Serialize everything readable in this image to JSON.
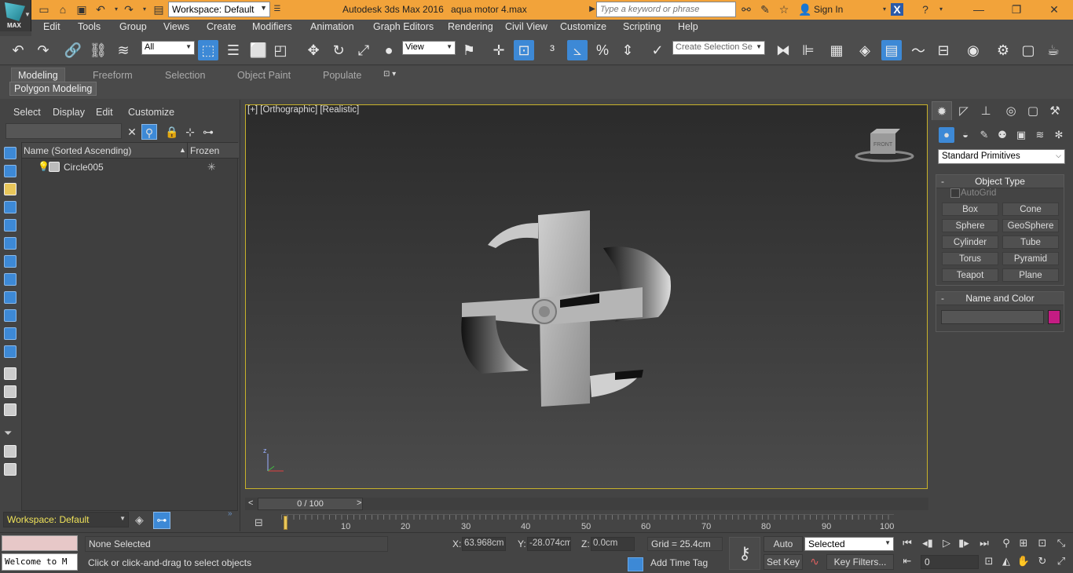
{
  "title_bar": {
    "workspace": "Workspace: Default",
    "app_name": "Autodesk 3ds Max 2016",
    "file_name": "aqua motor 4.max",
    "search_placeholder": "Type a keyword or phrase",
    "sign_in": "Sign In",
    "logo_text": "MAX"
  },
  "menu": [
    "Edit",
    "Tools",
    "Group",
    "Views",
    "Create",
    "Modifiers",
    "Animation",
    "Graph Editors",
    "Rendering",
    "Civil View",
    "Customize",
    "Scripting",
    "Help"
  ],
  "toolbar": {
    "filter_select": "All",
    "ref_coord_select": "View",
    "selection_set": "Create Selection Se"
  },
  "ribbon": {
    "tabs": [
      "Modeling",
      "Freeform",
      "Selection",
      "Object Paint",
      "Populate"
    ],
    "active_tab": "Modeling",
    "panel_label": "Polygon Modeling"
  },
  "scene_explorer": {
    "menu": [
      "Select",
      "Display",
      "Edit",
      "Customize"
    ],
    "columns": [
      "Name (Sorted Ascending)",
      "Frozen"
    ],
    "rows": [
      {
        "name": "Circle005"
      }
    ],
    "workspace": "Workspace: Default"
  },
  "viewport": {
    "label": "[+] [Orthographic] [Realistic]",
    "viewcube_face": "FRONT",
    "axis_z": "z"
  },
  "command_panel": {
    "category": "Standard Primitives",
    "object_type_title": "Object Type",
    "autogrid": "AutoGrid",
    "primitives": [
      "Box",
      "Cone",
      "Sphere",
      "GeoSphere",
      "Cylinder",
      "Tube",
      "Torus",
      "Pyramid",
      "Teapot",
      "Plane"
    ],
    "name_color_title": "Name and Color",
    "object_color": "#c41c83"
  },
  "timeline": {
    "frame_display": "0 / 100",
    "ticks": [
      "0",
      "10",
      "20",
      "30",
      "40",
      "50",
      "60",
      "70",
      "80",
      "90",
      "100"
    ]
  },
  "status": {
    "maxscript": "Welcome to M",
    "selection": "None Selected",
    "prompt": "Click or click-and-drag to select objects",
    "x_label": "X:",
    "x_value": "63.968cm",
    "y_label": "Y:",
    "y_value": "-28.074cm",
    "z_label": "Z:",
    "z_value": "0.0cm",
    "grid": "Grid = 25.4cm",
    "add_time_tag": "Add Time Tag",
    "auto_key": "Auto Key",
    "set_key": "Set Key",
    "selected": "Selected",
    "key_filters": "Key Filters...",
    "current_frame": "0"
  }
}
